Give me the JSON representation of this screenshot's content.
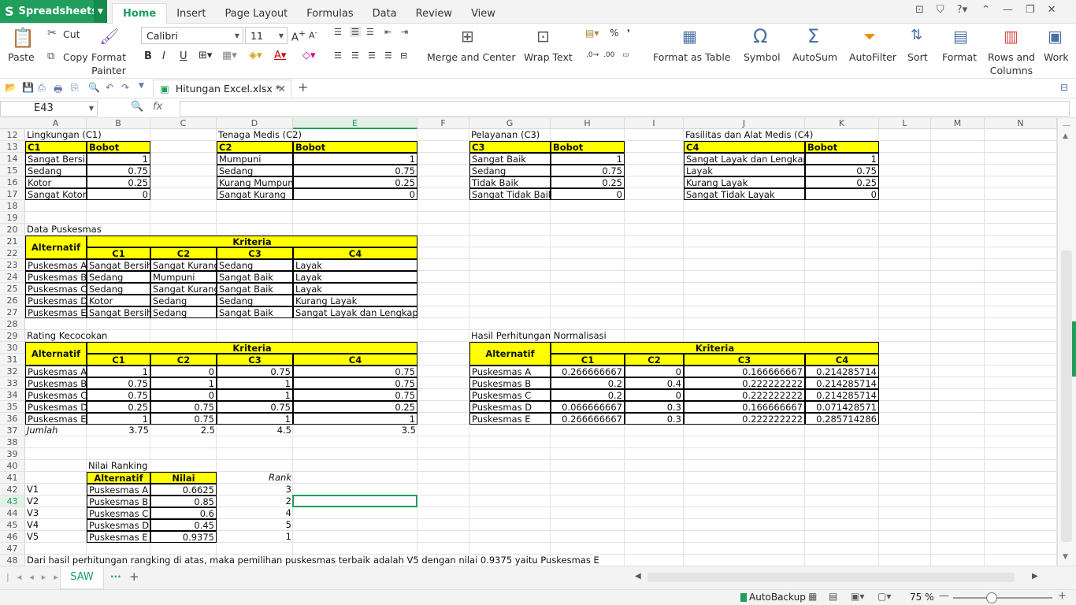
{
  "app": {
    "name": "Spreadsheets"
  },
  "menu_tabs": [
    "Home",
    "Insert",
    "Page Layout",
    "Formulas",
    "Data",
    "Review",
    "View"
  ],
  "ribbon": {
    "paste": "Paste",
    "cut": "Cut",
    "copy": "Copy",
    "format_painter_1": "Format",
    "format_painter_2": "Painter",
    "font": "Calibri",
    "size": "11",
    "merge": "Merge and Center",
    "wrap": "Wrap Text",
    "format_table": "Format as Table",
    "symbol": "Symbol",
    "autosum": "AutoSum",
    "autofilter": "AutoFilter",
    "sort": "Sort",
    "format": "Format",
    "rows_cols_1": "Rows and",
    "rows_cols_2": "Columns",
    "worksheet": "Work"
  },
  "doc_tab": "Hitungan Excel.xlsx *",
  "name_box": "E43",
  "fx_label": "fx",
  "columns": [
    "A",
    "B",
    "C",
    "D",
    "E",
    "F",
    "G",
    "H",
    "I",
    "J",
    "K",
    "L",
    "M",
    "N"
  ],
  "rows": [
    "12",
    "13",
    "14",
    "15",
    "16",
    "17",
    "18",
    "19",
    "20",
    "21",
    "22",
    "23",
    "24",
    "25",
    "26",
    "27",
    "28",
    "29",
    "30",
    "31",
    "32",
    "33",
    "34",
    "35",
    "36",
    "37",
    "38",
    "39",
    "40",
    "41",
    "42",
    "43",
    "44",
    "45",
    "46",
    "47",
    "48"
  ],
  "tables": {
    "c1": {
      "title": "Lingkungan (C1)",
      "h1": "C1",
      "h2": "Bobot",
      "rows": [
        [
          "Sangat Bersih",
          "1"
        ],
        [
          "Sedang",
          "0.75"
        ],
        [
          "Kotor",
          "0.25"
        ],
        [
          "Sangat Kotor",
          "0"
        ]
      ]
    },
    "c2": {
      "title": "Tenaga Medis (C2)",
      "h1": "C2",
      "h2": "Bobot",
      "rows": [
        [
          "Mumpuni",
          "1"
        ],
        [
          "Sedang",
          "0.75"
        ],
        [
          "Kurang Mumpuni",
          "0.25"
        ],
        [
          "Sangat Kurang",
          "0"
        ]
      ]
    },
    "c3": {
      "title": "Pelayanan (C3)",
      "h1": "C3",
      "h2": "Bobot",
      "rows": [
        [
          "Sangat Baik",
          "1"
        ],
        [
          "Sedang",
          "0.75"
        ],
        [
          "Tidak Baik",
          "0.25"
        ],
        [
          "Sangat Tidak Baik",
          "0"
        ]
      ]
    },
    "c4": {
      "title": "Fasilitas dan Alat Medis (C4)",
      "h1": "C4",
      "h2": "Bobot",
      "rows": [
        [
          "Sangat Layak dan Lengkap",
          "1"
        ],
        [
          "Layak",
          "0.75"
        ],
        [
          "Kurang Layak",
          "0.25"
        ],
        [
          "Sangat Tidak Layak",
          "0"
        ]
      ]
    }
  },
  "data_puskesmas": {
    "title": "Data Puskesmas",
    "alt": "Alternatif",
    "kriteria": "Kriteria",
    "cols": [
      "C1",
      "C2",
      "C3",
      "C4"
    ],
    "rows": [
      [
        "Puskesmas A",
        "Sangat Bersih",
        "Sangat Kurang",
        "Sedang",
        "Layak"
      ],
      [
        "Puskesmas B",
        "Sedang",
        "Mumpuni",
        "Sangat Baik",
        "Layak"
      ],
      [
        "Puskesmas C",
        "Sedang",
        "Sangat Kurang",
        "Sangat Baik",
        "Layak"
      ],
      [
        "Puskesmas D",
        "Kotor",
        "Sedang",
        "Sedang",
        "Kurang Layak"
      ],
      [
        "Puskesmas E",
        "Sangat Bersih",
        "Sedang",
        "Sangat Baik",
        "Sangat Layak dan Lengkap"
      ]
    ]
  },
  "rating": {
    "title": "Rating Kecocokan",
    "alt": "Alternatif",
    "kriteria": "Kriteria",
    "cols": [
      "C1",
      "C2",
      "C3",
      "C4"
    ],
    "rows": [
      [
        "Puskesmas A",
        "1",
        "0",
        "0.75",
        "0.75"
      ],
      [
        "Puskesmas B",
        "0.75",
        "1",
        "1",
        "0.75"
      ],
      [
        "Puskesmas C",
        "0.75",
        "0",
        "1",
        "0.75"
      ],
      [
        "Puskesmas D",
        "0.25",
        "0.75",
        "0.75",
        "0.25"
      ],
      [
        "Puskesmas E",
        "1",
        "0.75",
        "1",
        "1"
      ]
    ],
    "jumlah": [
      "Jumlah",
      "3.75",
      "2.5",
      "4.5",
      "3.5"
    ]
  },
  "normalisasi": {
    "title": "Hasil Perhitungan Normalisasi",
    "alt": "Alternatif",
    "kriteria": "Kriteria",
    "cols": [
      "C1",
      "C2",
      "C3",
      "C4"
    ],
    "rows": [
      [
        "Puskesmas A",
        "0.266666667",
        "0",
        "0.166666667",
        "0.214285714"
      ],
      [
        "Puskesmas B",
        "0.2",
        "0.4",
        "0.222222222",
        "0.214285714"
      ],
      [
        "Puskesmas C",
        "0.2",
        "0",
        "0.222222222",
        "0.214285714"
      ],
      [
        "Puskesmas D",
        "0.066666667",
        "0.3",
        "0.166666667",
        "0.071428571"
      ],
      [
        "Puskesmas E",
        "0.266666667",
        "0.3",
        "0.222222222",
        "0.285714286"
      ]
    ]
  },
  "ranking": {
    "title": "Nilai Ranking",
    "alt": "Alternatif",
    "nilai": "Nilai",
    "rank": "Rank",
    "rows": [
      [
        "V1",
        "Puskesmas A",
        "0.6625",
        "3"
      ],
      [
        "V2",
        "Puskesmas B",
        "0.85",
        "2"
      ],
      [
        "V3",
        "Puskesmas C",
        "0.6",
        "4"
      ],
      [
        "V4",
        "Puskesmas D",
        "0.45",
        "5"
      ],
      [
        "V5",
        "Puskesmas E",
        "0.9375",
        "1"
      ]
    ]
  },
  "conclusion": "Dari hasil perhitungan rangking di atas, maka pemilihan puskesmas terbaik adalah V5 dengan nilai 0.9375 yaitu Puskesmas E",
  "sheet_tab": "SAW",
  "status": {
    "autobackup": "AutoBackup",
    "zoom": "75 %"
  }
}
